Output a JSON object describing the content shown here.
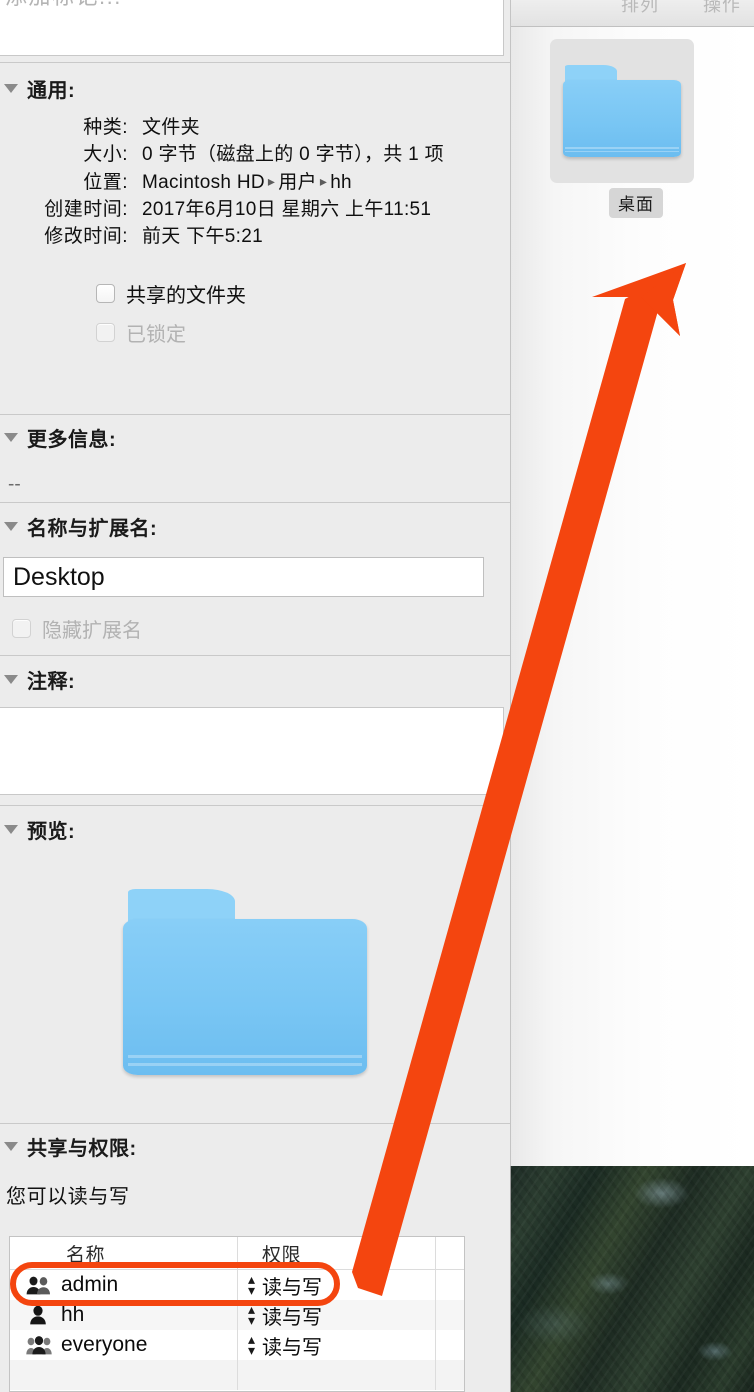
{
  "info_window": {
    "tags": {
      "placeholder": "添加标记..."
    },
    "general": {
      "title": "通用:",
      "rows": [
        {
          "key": "种类:",
          "value": "文件夹"
        },
        {
          "key": "大小:",
          "value": "0 字节（磁盘上的 0 字节），共 1 项"
        },
        {
          "key": "位置:",
          "value_parts": [
            "Macintosh HD",
            "用户",
            "hh"
          ]
        },
        {
          "key": "创建时间:",
          "value": "2017年6月10日 星期六 上午11:51"
        },
        {
          "key": "修改时间:",
          "value": "前天 下午5:21"
        }
      ],
      "location_label": "位置:",
      "location_1": "Macintosh HD",
      "location_2": "用户",
      "location_3": "hh",
      "kind_key": "种类:",
      "kind_value": "文件夹",
      "size_key": "大小:",
      "size_value": "0 字节（磁盘上的 0 字节），共 1",
      "size_value_2": "项",
      "created_key": "创建时间:",
      "created_value": "2017年6月10日 星期六 上午11:51",
      "modified_key": "修改时间:",
      "modified_value": "前天 下午5:21",
      "shared_folder_label": "共享的文件夹",
      "shared_folder_checked": false,
      "locked_label": "已锁定",
      "locked_checked": false,
      "locked_disabled": true
    },
    "more_info": {
      "title": "更多信息:",
      "value": "--"
    },
    "name_extension": {
      "title": "名称与扩展名:",
      "name_value": "Desktop",
      "hide_extension_label": "隐藏扩展名",
      "hide_extension_checked": false
    },
    "comments": {
      "title": "注释:",
      "value": ""
    },
    "preview": {
      "title": "预览:",
      "icon": "folder-icon"
    },
    "sharing": {
      "title": "共享与权限:",
      "note": "您可以读与写",
      "columns": [
        "名称",
        "权限"
      ],
      "rows": [
        {
          "icon": "group-icon",
          "name": "admin",
          "privilege": "读与写"
        },
        {
          "icon": "user-icon",
          "name": "hh",
          "privilege": "读与写"
        },
        {
          "icon": "everyone-icon",
          "name": "everyone",
          "privilege": "读与写"
        }
      ]
    }
  },
  "finder_window": {
    "toolbar": {
      "arrange_label": "排列",
      "action_label": "操作"
    },
    "selected_item": {
      "label": "桌面",
      "icon": "folder-icon"
    }
  },
  "annotations": {
    "highlight_color": "#f4450f",
    "arrow_color": "#f4450f",
    "highlighted_row": "admin",
    "arrow_points_to": "桌面"
  }
}
